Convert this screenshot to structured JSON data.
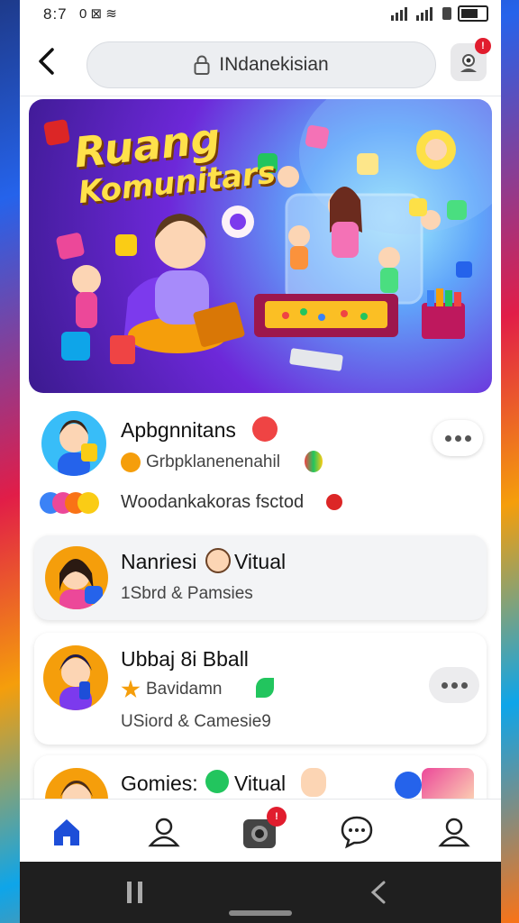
{
  "status_bar": {
    "time": "8:7",
    "left_icons": "0 ⊠ ≋"
  },
  "browser": {
    "url_text": "INdanekisian",
    "notification_count": "!"
  },
  "banner": {
    "title_line1": "Ruang",
    "title_line2": "Komunitars"
  },
  "feed": [
    {
      "name": "Apbgnnitans",
      "subtitle": "Grbpklanenenahil",
      "extra": "Woodankakoras fsctod"
    },
    {
      "name": "Nanriesi",
      "name_suffix": "Vitual",
      "subtitle": "1Sbrd & Pamsies"
    },
    {
      "name": "Ubbaj 8i Bball",
      "subtitle": "Bavidamn",
      "meta": "USiord & Camesie9"
    },
    {
      "name": "Gomies:",
      "name_suffix": "Vitual"
    }
  ],
  "nav": {
    "camera_badge": "!"
  },
  "colors": {
    "accent": "#1d4ed8",
    "notify": "#e11d2e",
    "banner_title": "#ffe14a"
  }
}
